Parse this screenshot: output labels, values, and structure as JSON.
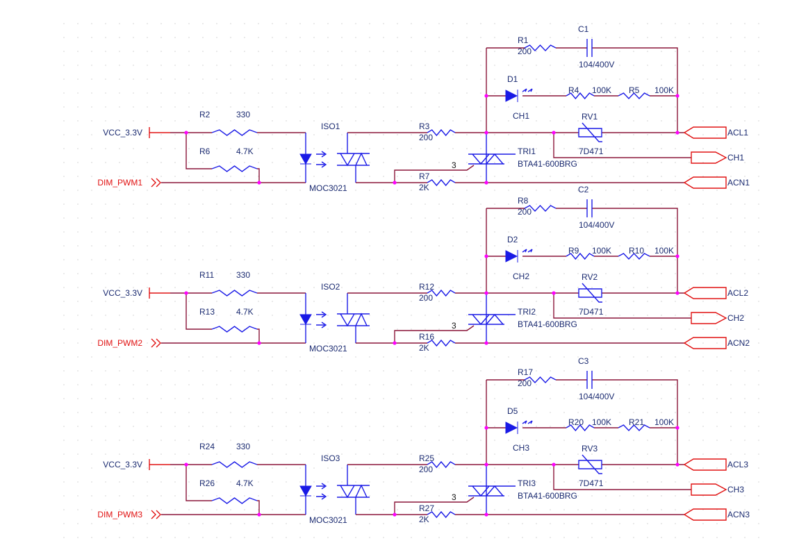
{
  "colors": {
    "wire": "#8a1538",
    "part": "#1a1ae6",
    "net_label": "#e01010",
    "junction": "#ff00ff",
    "text": "#1a2a70"
  },
  "channels": [
    {
      "vcc": "VCC_3.3V",
      "pwm": "DIM_PWM1",
      "r_a": "R2",
      "r_a_val": "330",
      "r_b": "R6",
      "r_b_val": "4.7K",
      "iso": "ISO1",
      "iso_part": "MOC3021",
      "r_gate": "R3",
      "r_gate_val": "200",
      "r_k": "R7",
      "r_k_val": "2K",
      "pin": "3",
      "tri": "TRI1",
      "tri_part": "BTA41-600BRG",
      "r_snub": "R1",
      "r_snub_val": "200",
      "cap": "C1",
      "cap_val": "104/400V",
      "led": "D1",
      "led_net": "CH1",
      "r_l1": "R4",
      "r_l1_val": "100K",
      "r_l2": "R5",
      "r_l2_val": "100K",
      "rv": "RV1",
      "rv_val": "7D471",
      "port_l": "ACL1",
      "port_ch": "CH1",
      "port_n": "ACN1"
    },
    {
      "vcc": "VCC_3.3V",
      "pwm": "DIM_PWM2",
      "r_a": "R11",
      "r_a_val": "330",
      "r_b": "R13",
      "r_b_val": "4.7K",
      "iso": "ISO2",
      "iso_part": "MOC3021",
      "r_gate": "R12",
      "r_gate_val": "200",
      "r_k": "R16",
      "r_k_val": "2K",
      "pin": "3",
      "tri": "TRI2",
      "tri_part": "BTA41-600BRG",
      "r_snub": "R8",
      "r_snub_val": "200",
      "cap": "C2",
      "cap_val": "104/400V",
      "led": "D2",
      "led_net": "CH2",
      "r_l1": "R9",
      "r_l1_val": "100K",
      "r_l2": "R10",
      "r_l2_val": "100K",
      "rv": "RV2",
      "rv_val": "7D471",
      "port_l": "ACL2",
      "port_ch": "CH2",
      "port_n": "ACN2"
    },
    {
      "vcc": "VCC_3.3V",
      "pwm": "DIM_PWM3",
      "r_a": "R24",
      "r_a_val": "330",
      "r_b": "R26",
      "r_b_val": "4.7K",
      "iso": "ISO3",
      "iso_part": "MOC3021",
      "r_gate": "R25",
      "r_gate_val": "200",
      "r_k": "R27",
      "r_k_val": "2K",
      "pin": "3",
      "tri": "TRI3",
      "tri_part": "BTA41-600BRG",
      "r_snub": "R17",
      "r_snub_val": "200",
      "cap": "C3",
      "cap_val": "104/400V",
      "led": "D5",
      "led_net": "CH3",
      "r_l1": "R20",
      "r_l1_val": "100K",
      "r_l2": "R21",
      "r_l2_val": "100K",
      "rv": "RV3",
      "rv_val": "7D471",
      "port_l": "ACL3",
      "port_ch": "CH3",
      "port_n": "ACN3"
    }
  ]
}
